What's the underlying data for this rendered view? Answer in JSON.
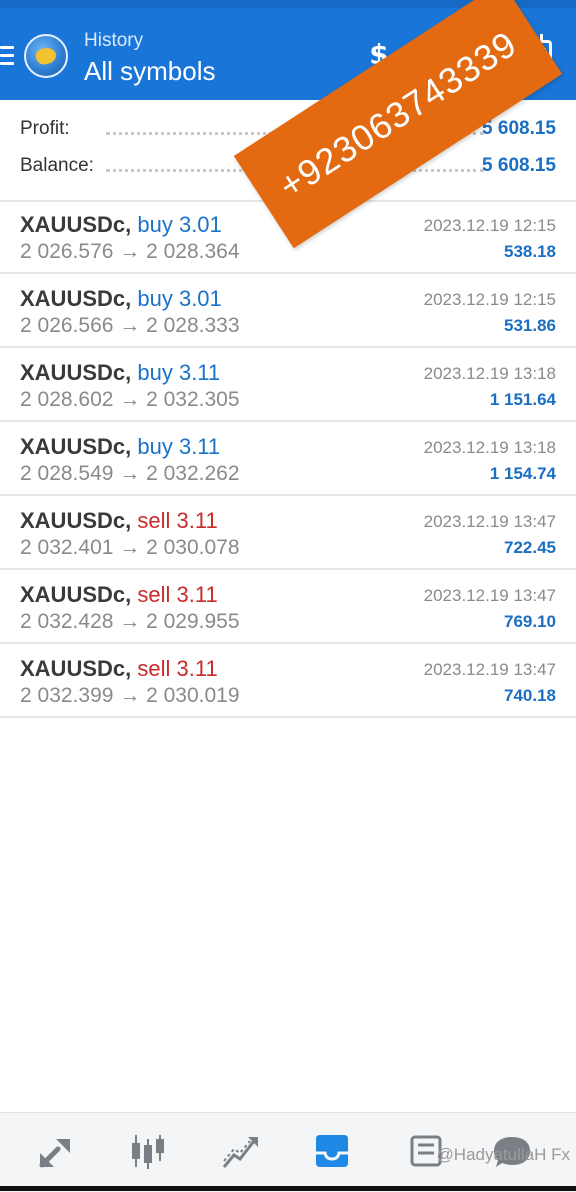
{
  "header": {
    "subtitle": "History",
    "title": "All symbols"
  },
  "summary": {
    "profit_label": "Profit:",
    "profit_value": "5 608.15",
    "balance_label": "Balance:",
    "balance_value": "5 608.15"
  },
  "deals": [
    {
      "symbol": "XAUUSDc,",
      "type": "buy 3.01",
      "direction": "buy",
      "prices": "2 026.576 → 2 028.364",
      "time": "2023.12.19 12:15",
      "profit": "538.18"
    },
    {
      "symbol": "XAUUSDc,",
      "type": "buy 3.01",
      "direction": "buy",
      "prices": "2 026.566 → 2 028.333",
      "time": "2023.12.19 12:15",
      "profit": "531.86"
    },
    {
      "symbol": "XAUUSDc,",
      "type": "buy 3.11",
      "direction": "buy",
      "prices": "2 028.602 → 2 032.305",
      "time": "2023.12.19 13:18",
      "profit": "1 151.64"
    },
    {
      "symbol": "XAUUSDc,",
      "type": "buy 3.11",
      "direction": "buy",
      "prices": "2 028.549 → 2 032.262",
      "time": "2023.12.19 13:18",
      "profit": "1 154.74"
    },
    {
      "symbol": "XAUUSDc,",
      "type": "sell 3.11",
      "direction": "sell",
      "prices": "2 032.401 → 2 030.078",
      "time": "2023.12.19 13:47",
      "profit": "722.45"
    },
    {
      "symbol": "XAUUSDc,",
      "type": "sell 3.11",
      "direction": "sell",
      "prices": "2 032.428 → 2 029.955",
      "time": "2023.12.19 13:47",
      "profit": "769.10"
    },
    {
      "symbol": "XAUUSDc,",
      "type": "sell 3.11",
      "direction": "sell",
      "prices": "2 032.399 → 2 030.019",
      "time": "2023.12.19 13:47",
      "profit": "740.18"
    }
  ],
  "banner": {
    "text": "+923063743339",
    "color": "#e36a10"
  },
  "watermark": {
    "text": "@HadyatullaH Fx"
  },
  "colors": {
    "header": "#1976d8",
    "buy": "#1a73c9",
    "sell": "#c92a2a",
    "profit": "#1a6fc4"
  },
  "nav": {
    "icons": [
      "quotes-icon",
      "chart-icon",
      "trade-icon",
      "history-icon",
      "messages-icon",
      "news-icon"
    ],
    "active": "history-icon"
  }
}
